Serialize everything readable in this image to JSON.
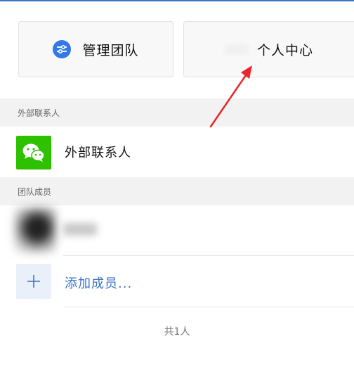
{
  "cards": {
    "manage_team": "管理团队",
    "personal_center": "个人中心"
  },
  "sections": {
    "external_contacts_header": "外部联系人",
    "team_members_header": "团队成员"
  },
  "external_contacts": {
    "label": "外部联系人",
    "icon": "wechat-icon"
  },
  "members": {
    "add_member_label": "添加成员...",
    "total": "共1人"
  },
  "colors": {
    "accent_blue": "#3478e5",
    "wechat_green": "#2dc100",
    "link_blue": "#3a73c4",
    "annotation_red": "#e8262c"
  }
}
